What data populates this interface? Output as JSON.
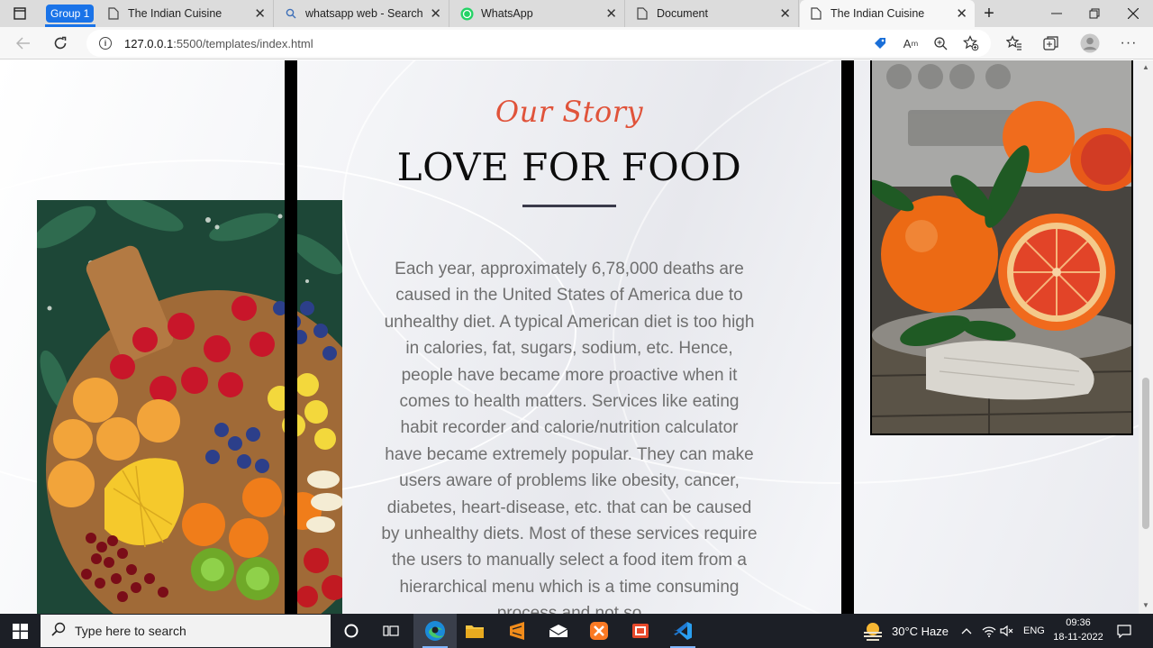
{
  "browser": {
    "group_label": "Group 1",
    "tabs": [
      {
        "title": "The Indian Cuisine",
        "icon": "page-icon",
        "active": false
      },
      {
        "title": "whatsapp web - Search",
        "icon": "search-icon",
        "active": false
      },
      {
        "title": "WhatsApp",
        "icon": "whatsapp-icon",
        "active": false
      },
      {
        "title": "Document",
        "icon": "page-icon",
        "active": false
      },
      {
        "title": "The Indian Cuisine",
        "icon": "page-icon",
        "active": true
      }
    ],
    "new_tab": "+",
    "address": {
      "host": "127.0.0.1",
      "path": ":5500/templates/index.html"
    }
  },
  "page": {
    "kicker": "Our Story",
    "title": "LOVE FOR FOOD",
    "body": "Each year, approximately 6,78,000 deaths are caused in the United States of America due to unhealthy diet. A typical American diet is too high in calories, fat, sugars, sodium, etc. Hence, people have became more proactive when it comes to health matters. Services like eating habit recorder and calorie/nutrition calculator have became extremely popular. They can make users aware of problems like obesity, cancer, diabetes, heart-disease, etc. that can be caused by unhealthy diets. Most of these services require the users to manually select a food item from a hierarchical menu which is a time consuming process and not so"
  },
  "taskbar": {
    "search_placeholder": "Type here to search",
    "weather": "30°C  Haze",
    "language": "ENG",
    "time": "09:36",
    "date": "18-11-2022"
  },
  "colors": {
    "accent": "#e0533a",
    "title": "#0c0c0c",
    "body_text": "#6f6f6f",
    "group_blue": "#1a73e8",
    "taskbar": "#1c1f26"
  }
}
